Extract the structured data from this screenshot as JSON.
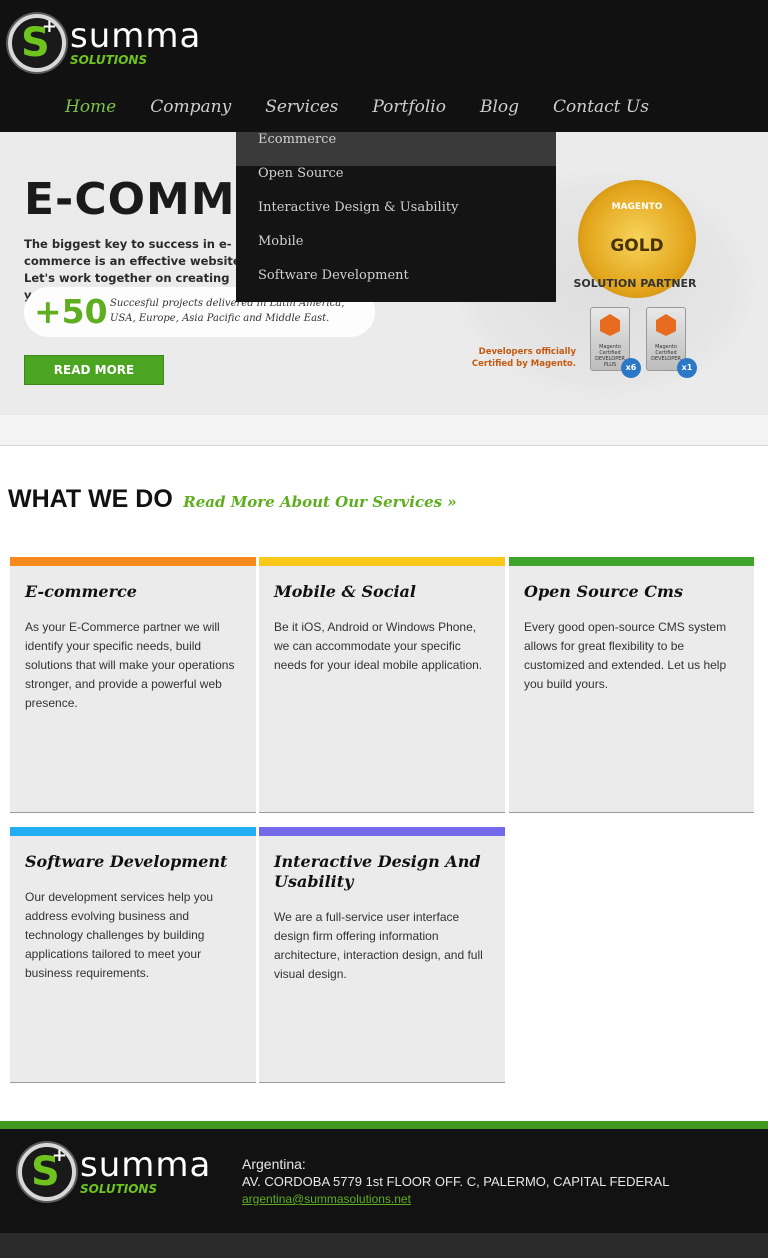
{
  "logo": {
    "brand": "summa",
    "sub": "SOLUTIONS",
    "letter": "S",
    "plus": "+"
  },
  "nav": {
    "items": [
      {
        "label": "Home",
        "active": true
      },
      {
        "label": "Company"
      },
      {
        "label": "Services"
      },
      {
        "label": "Portfolio"
      },
      {
        "label": "Blog"
      },
      {
        "label": "Contact Us"
      }
    ]
  },
  "dropdown": {
    "items": [
      "Ecommerce",
      "Open Source",
      "Interactive Design & Usability",
      "Mobile",
      "Software Development"
    ]
  },
  "banner": {
    "headline": "E-COMMERCE",
    "lead": "The biggest key to success in e-commerce is an effective website. Let's work together on creating yours.",
    "stat": "+50",
    "stat_text": "Succesful projects delivered in Latin America, USA, Europe, Asia Pacific and Middle East.",
    "read_more": "READ MORE",
    "medal_top": "MAGENTO",
    "medal_main": "GOLD",
    "partner": "SOLUTION PARTNER",
    "cert_note": "Developers officially Certified by Magento.",
    "badge1": {
      "label": "Magento Certified DEVELOPER PLUS",
      "count": "x6"
    },
    "badge2": {
      "label": "Magento Certified DEVELOPER",
      "count": "x1"
    }
  },
  "what_we_do": {
    "title": "WHAT WE DO",
    "link": "Read More About Our Services »"
  },
  "cards": [
    {
      "title": "E-commerce",
      "color": "#f7891d",
      "text": "As your E-Commerce partner we will identify your specific needs, build solutions that will make your operations stronger, and provide a powerful web presence."
    },
    {
      "title": "Mobile & Social",
      "color": "#f9c91a",
      "text": "Be it iOS, Android or Windows Phone, we can accommodate your specific needs for your ideal mobile application."
    },
    {
      "title": "Open Source Cms",
      "color": "#3fa52a",
      "text": "Every good open-source CMS system allows for great flexibility to be customized and extended. Let us help you build yours."
    },
    {
      "title": "Software Development",
      "color": "#22aef0",
      "text": "Our development services help you address evolving business and technology challenges by building applications tailored to meet your business requirements."
    },
    {
      "title": "Interactive Design And Usability",
      "color": "#7369ea",
      "text": "We are a full-service user interface design firm offering information architecture, interaction design, and full visual design."
    }
  ],
  "footer": {
    "country": "Argentina:",
    "address": "AV. CORDOBA 5779 1st FLOOR OFF. C, PALERMO, CAPITAL FEDERAL",
    "email": "argentina@summasolutions.net"
  }
}
